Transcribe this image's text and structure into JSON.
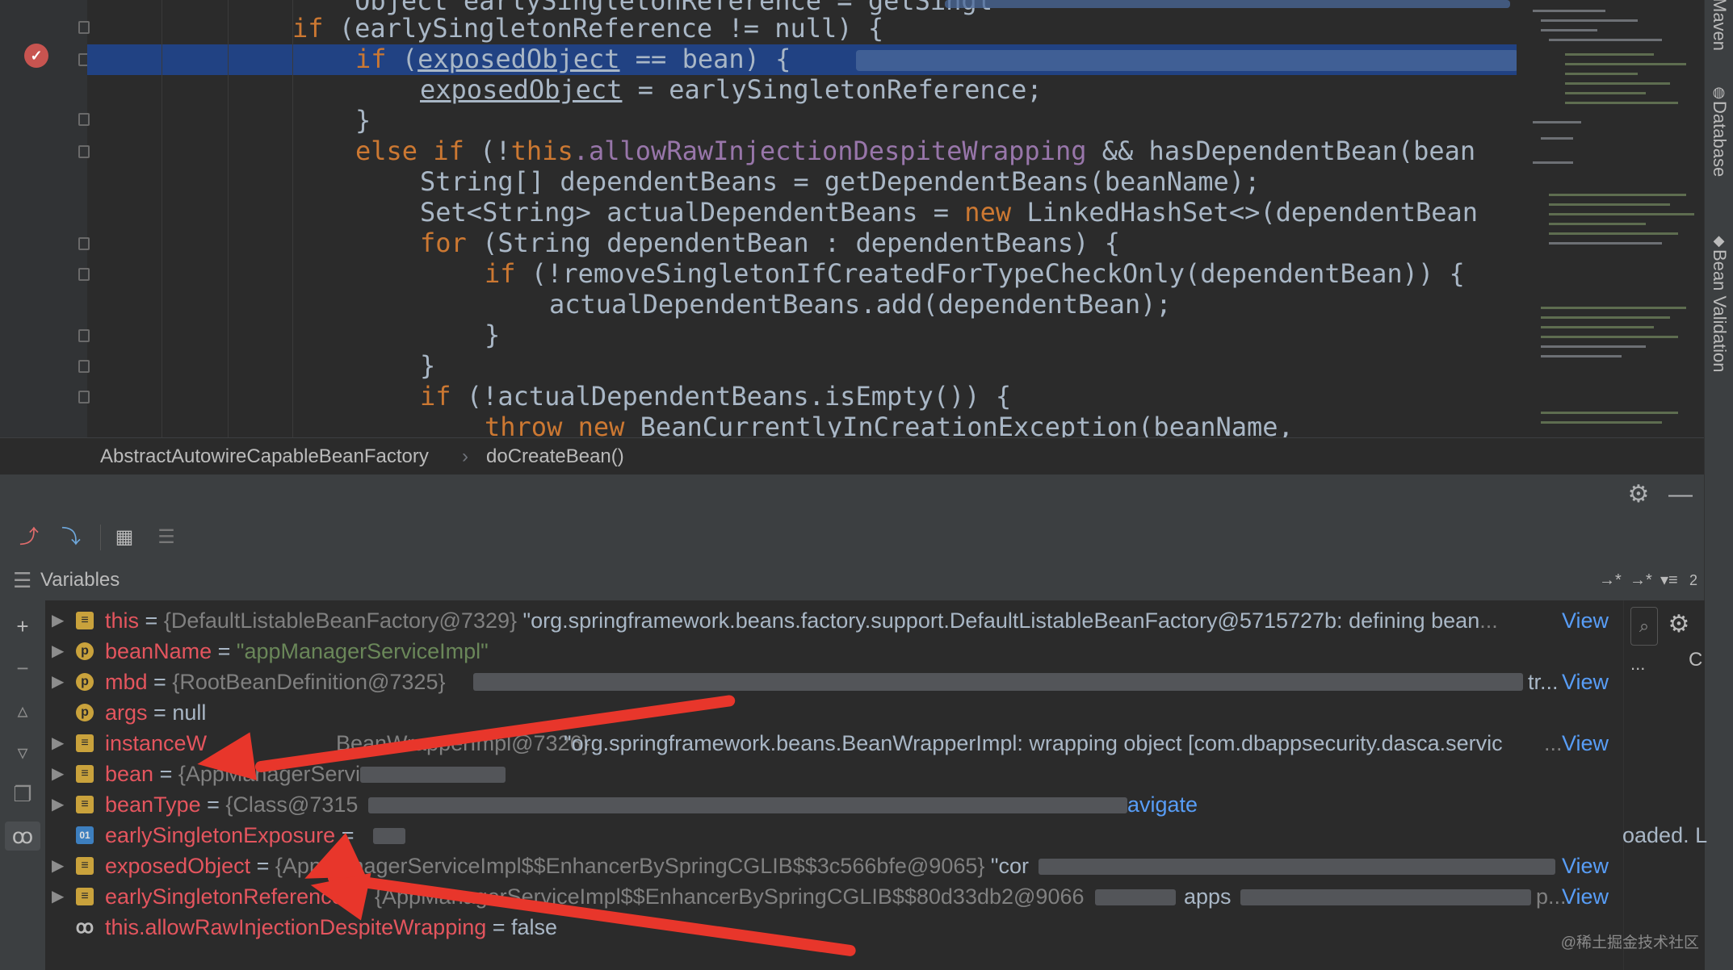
{
  "editor": {
    "lines": [
      {
        "html_top": 0,
        "segments": [
          [
            "",
            "Object earlySingletonReference = getSingl",
            "plain"
          ]
        ]
      },
      {
        "segments": []
      }
    ],
    "code": {
      "l0": "    Object earlySingletonReference = getSingl",
      "l1_kw": "if",
      "l1_rest": " (earlySingletonReference != null) {",
      "l2_kw": "if",
      "l2_var": "exposedObject",
      "l2_rest": " == bean) {",
      "l3_var": "exposedObject",
      "l3_rest": " = earlySingletonReference;",
      "l4": "}",
      "l5_kw": "else if",
      "l5_a": " (!",
      "l5_this": "this",
      "l5_field": ".allowRawInjectionDespiteWrapping",
      "l5_b": " && hasDependentBean(bean",
      "l6": "String[] dependentBeans = getDependentBeans(beanName);",
      "l7_a": "Set<String> actualDependentBeans = ",
      "l7_kw": "new",
      "l7_b": " LinkedHashSet<>(dependentBean",
      "l8_kw": "for",
      "l8_rest": " (String dependentBean : dependentBeans) {",
      "l9_kw": "if",
      "l9_rest": " (!removeSingletonIfCreatedForTypeCheckOnly(dependentBean)) {",
      "l10": "actualDependentBeans.add(dependentBean);",
      "l11": "}",
      "l12": "}",
      "l13_kw": "if",
      "l13_rest": " (!actualDependentBeans.isEmpty()) {",
      "l14_kw": "throw new",
      "l14_rest": " BeanCurrentlyInCreationException(beanName,"
    }
  },
  "breadcrumb": {
    "class_name": "AbstractAutowireCapableBeanFactory",
    "separator": "›",
    "method_name": "doCreateBean()"
  },
  "right_tabs": {
    "maven": "Maven",
    "database": "Database",
    "bean_validation": "Bean Validation"
  },
  "variables_panel": {
    "title": "Variables",
    "layout_counter": "2",
    "rows": [
      {
        "name": "this",
        "eq": " = ",
        "value": "{DefaultListableBeanFactory@7329}",
        "text": " \"org.springframework.beans.factory.support.DefaultListableBeanFactory@5715727b: defining bean",
        "suffix": "...",
        "view": "View"
      },
      {
        "name": "beanName",
        "eq": " = ",
        "value": "\"appManagerServiceImpl\""
      },
      {
        "name": "mbd",
        "eq": " = ",
        "value": "{RootBeanDefinition@7325}",
        "suffix": "tr...",
        "view": "View"
      },
      {
        "name": "args",
        "eq": " = ",
        "value": "null"
      },
      {
        "name": "instanceW",
        "value": "BeanWrapperImpl@7326}",
        "text": " \"org.springframework.beans.BeanWrapperImpl: wrapping object [com.dbappsecurity.dasca.servic",
        "suffix": "...",
        "view": "View"
      },
      {
        "name": "bean",
        "eq": " = ",
        "value": "{AppManagerServi"
      },
      {
        "name": "beanType",
        "eq": " = ",
        "value": "{Class@7315",
        "link": "avigate"
      },
      {
        "name": "earlySingletonExposure",
        "eq": " = "
      },
      {
        "name": "exposedObject",
        "eq": " = ",
        "value": "{AppManagerServiceImpl$$EnhancerBySpringCGLIB$$3c566bfe@9065}",
        "text": " \"cor",
        "view": "View"
      },
      {
        "name": "earlySingletonReference",
        "value": "{AppManagerServiceImpl$$EnhancerBySpringCGLIB$$80d33db2@9066",
        "text": "apps",
        "suffix": "p...",
        "view": "View"
      },
      {
        "name": "this.allowRawInjectionDespiteWrapping",
        "eq": " = ",
        "value": "false"
      }
    ],
    "side_text": "oaded. L",
    "side_btn": "...",
    "side_c": "C"
  },
  "watermark": "@稀土掘金技术社区",
  "colors": {
    "editor_bg": "#2b2b2b",
    "keyword": "#cc7832",
    "field": "#9876aa",
    "var_name": "#e4555e",
    "string": "#6a8759",
    "link": "#589df6",
    "highlight": "#214283",
    "annotation_arrow": "#e8362b"
  },
  "icons": {
    "breakpoint": "breakpoint-icon",
    "settings": "gear-icon",
    "minimize": "minimize-icon",
    "add_watch": "plus-icon",
    "watches": "glasses-icon"
  }
}
